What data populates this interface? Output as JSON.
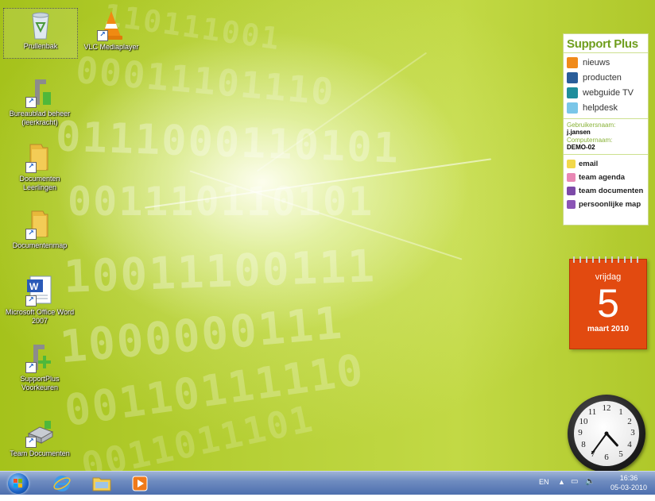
{
  "desktop_icons": [
    {
      "label": "Prullenbak",
      "icon": "recycle-bin-icon"
    },
    {
      "label": "VLC Mediaplayer",
      "icon": "vlc-icon"
    },
    {
      "label": "Bureaublad beheer (leerkracht)",
      "icon": "desktop-manage-icon"
    },
    {
      "label": "Documenten Leerlingen",
      "icon": "folder-shared-icon"
    },
    {
      "label": "Documentenmap",
      "icon": "folder-icon"
    },
    {
      "label": "Microsoft Office Word 2007",
      "icon": "word-icon"
    },
    {
      "label": "SupportPlus Voorkeuren",
      "icon": "supportplus-prefs-icon"
    },
    {
      "label": "Team Documenten",
      "icon": "team-docs-icon"
    }
  ],
  "support_plus": {
    "title": "Support Plus",
    "menu": [
      {
        "label": "nieuws",
        "icon": "news-icon",
        "color": "#f08a1a"
      },
      {
        "label": "producten",
        "icon": "cart-icon",
        "color": "#2a5e9a"
      },
      {
        "label": "webguide TV",
        "icon": "tv-icon",
        "color": "#1f8e9c"
      },
      {
        "label": "helpdesk",
        "icon": "help-icon",
        "color": "#7ac6e8"
      }
    ],
    "user_label": "Gebruikersnaam:",
    "user_value": "j.jansen",
    "computer_label": "Computernaam:",
    "computer_value": "DEMO-02",
    "links": [
      {
        "label": "email",
        "icon": "email-icon",
        "color": "#f2d84a"
      },
      {
        "label": "team agenda",
        "icon": "agenda-icon",
        "color": "#e887b4"
      },
      {
        "label": "team documenten",
        "icon": "team-documents-icon",
        "color": "#7d4aa8"
      },
      {
        "label": "persoonlijke map",
        "icon": "personal-folder-icon",
        "color": "#8b55b6"
      }
    ]
  },
  "calendar": {
    "weekday": "vrijdag",
    "day": "5",
    "month_year": "maart 2010"
  },
  "clock": {
    "hour": 4,
    "minute": 36
  },
  "taskbar": {
    "pinned": [
      "internet-explorer-icon",
      "explorer-folder-icon",
      "media-player-icon"
    ],
    "lang": "EN",
    "time": "16:36",
    "date": "05-03-2010"
  },
  "colors": {
    "sp_green": "#6f9e1e",
    "calendar_orange": "#e24a10"
  }
}
